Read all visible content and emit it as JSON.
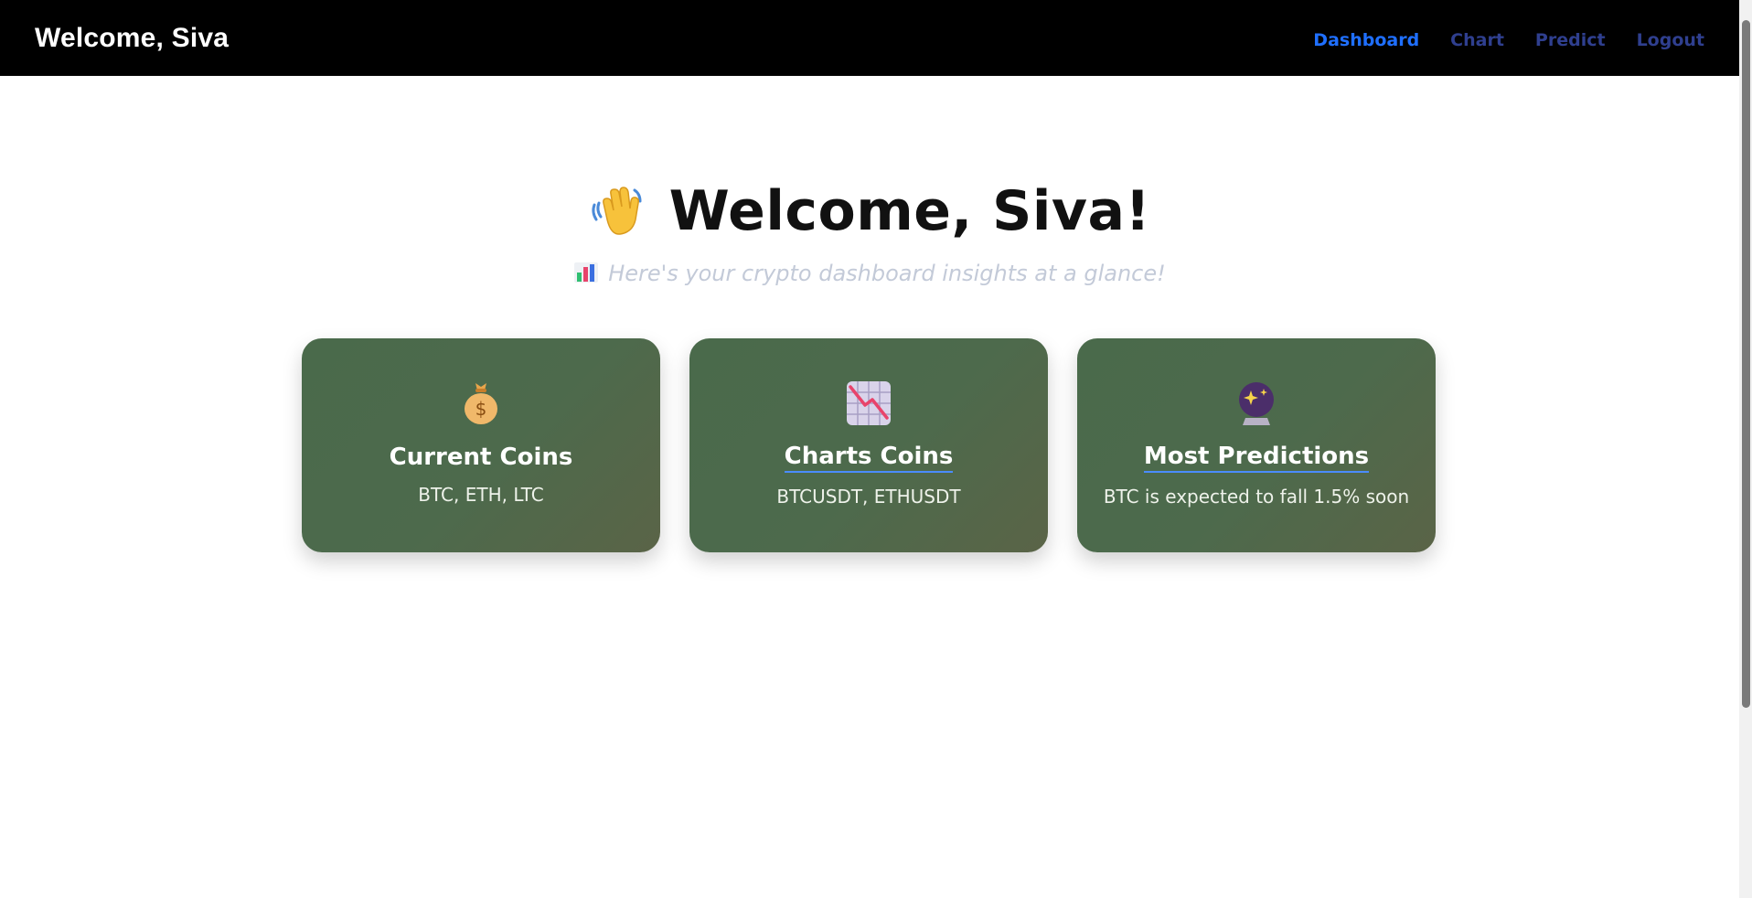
{
  "navbar": {
    "brand": "Welcome, Siva",
    "links": [
      {
        "label": "Dashboard",
        "active": true
      },
      {
        "label": "Chart",
        "active": false
      },
      {
        "label": "Predict",
        "active": false
      },
      {
        "label": "Logout",
        "active": false
      }
    ]
  },
  "hero": {
    "title": "Welcome, Siva!",
    "title_icon": "waving-hand-icon",
    "subtitle": "Here's your crypto dashboard insights at a glance!",
    "subtitle_icon": "bar-chart-icon"
  },
  "cards": [
    {
      "icon": "money-bag-icon",
      "title": "Current Coins",
      "text": "BTC, ETH, LTC"
    },
    {
      "icon": "chart-decreasing-icon",
      "title": "Charts Coins",
      "text": "BTCUSDT, ETHUSDT"
    },
    {
      "icon": "crystal-ball-icon",
      "title": "Most Predictions",
      "text": "BTC is expected to fall 1.5% soon"
    }
  ],
  "colors": {
    "navbar_bg": "#000000",
    "nav_active": "#1f6fff",
    "nav_link": "#2f3f8f",
    "card_bg": "#4d6a4c",
    "subtitle": "#c3cad8"
  }
}
